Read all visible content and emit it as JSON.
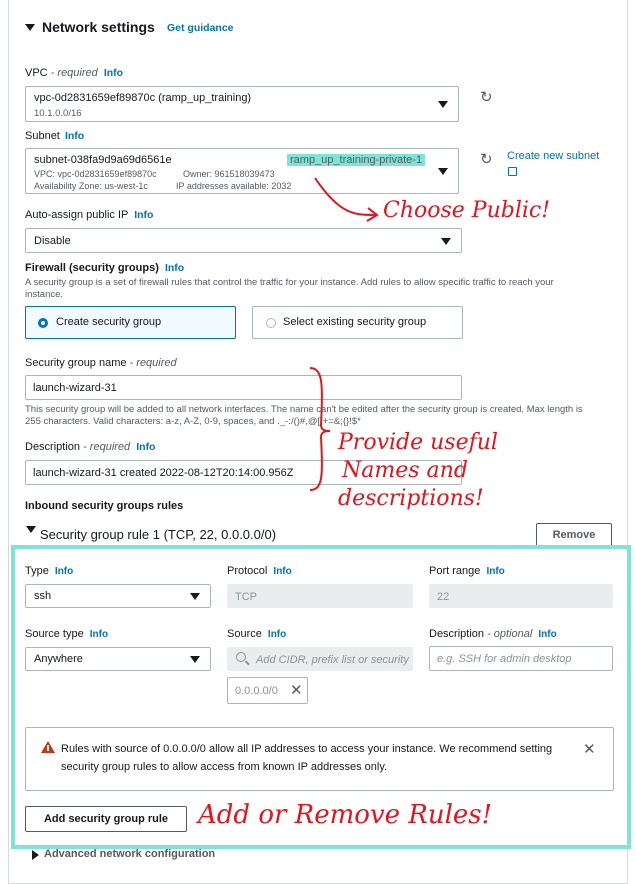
{
  "header": {
    "title": "Network settings",
    "guidance": "Get guidance"
  },
  "vpc": {
    "label": "VPC",
    "required": " - required",
    "info": "Info",
    "value": "vpc-0d2831659ef89870c (ramp_up_training)",
    "sub": "10.1.0.0/16"
  },
  "subnet": {
    "label": "Subnet",
    "info": "Info",
    "id": "subnet-038fa9d9a69d6561e",
    "name": "ramp_up_training-private-1",
    "vpc": "VPC: vpc-0d2831659ef89870c",
    "owner": "Owner: 961518039473",
    "az": "Availability Zone: us-west-1c",
    "ips": "IP addresses available: 2032",
    "create": "Create new subnet"
  },
  "public_ip": {
    "label": "Auto-assign public IP",
    "info": "Info",
    "value": "Disable"
  },
  "firewall": {
    "label": "Firewall (security groups)",
    "info": "Info",
    "help1": "A security group is a set of firewall rules that control the traffic for your instance. Add rules to allow specific traffic to reach your",
    "help2": "instance.",
    "create": "Create security group",
    "existing": "Select existing security group"
  },
  "sg_name": {
    "label": "Security group name",
    "required": " - required",
    "value": "launch-wizard-31",
    "help1": "This security group will be added to all network interfaces. The name can't be edited after the security group is created. Max length is",
    "help2": "255 characters. Valid characters: a-z, A-Z, 0-9, spaces, and ._-:/()#,@[]+=&;{}!$*"
  },
  "description": {
    "label": "Description",
    "required": " - required",
    "info": "Info",
    "value": "launch-wizard-31 created 2022-08-12T20:14:00.956Z"
  },
  "inbound": {
    "title": "Inbound security groups rules",
    "rule_title": "Security group rule 1 (TCP, 22, 0.0.0.0/0)",
    "remove": "Remove",
    "type_label": "Type",
    "type_value": "ssh",
    "protocol_label": "Protocol",
    "protocol_value": "TCP",
    "port_label": "Port range",
    "port_value": "22",
    "source_type_label": "Source type",
    "source_type_value": "Anywhere",
    "source_label": "Source",
    "source_placeholder": "Add CIDR, prefix list or security",
    "source_token": "0.0.0.0/0",
    "desc_label": "Description",
    "desc_optional": " - optional",
    "desc_placeholder": "e.g. SSH for admin desktop",
    "info": "Info",
    "warning1": "Rules with source of 0.0.0.0/0 allow all IP addresses to access your instance. We recommend setting",
    "warning2": "security group rules to allow access from known IP addresses only.",
    "add_rule": "Add security group rule",
    "advanced": "Advanced network configuration"
  },
  "annotations": {
    "choose_public": "Choose Public!",
    "names_line1": "Provide useful",
    "names_line2": "Names and",
    "names_line3": "descriptions!",
    "rules": "Add or Remove Rules!"
  },
  "colors": {
    "accent": "#0073bb",
    "highlight": "#7fe3d8",
    "annotation": "#e8121c",
    "warning": "#d13212"
  }
}
